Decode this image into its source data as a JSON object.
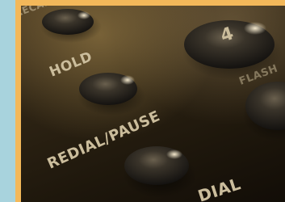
{
  "photo": {
    "subject": "phone-keypad-closeup",
    "labels": {
      "top_partial": "RECALL",
      "hold": "HOLD",
      "redial_pause": "REDIAL/PAUSE",
      "dial_partial": "DIAL",
      "key_digit": "4",
      "right_partial": "FLASH"
    }
  },
  "colors": {
    "frame": "#f3b85a",
    "left_strip": "#a8d3dd",
    "label": "#cbbd9c"
  }
}
